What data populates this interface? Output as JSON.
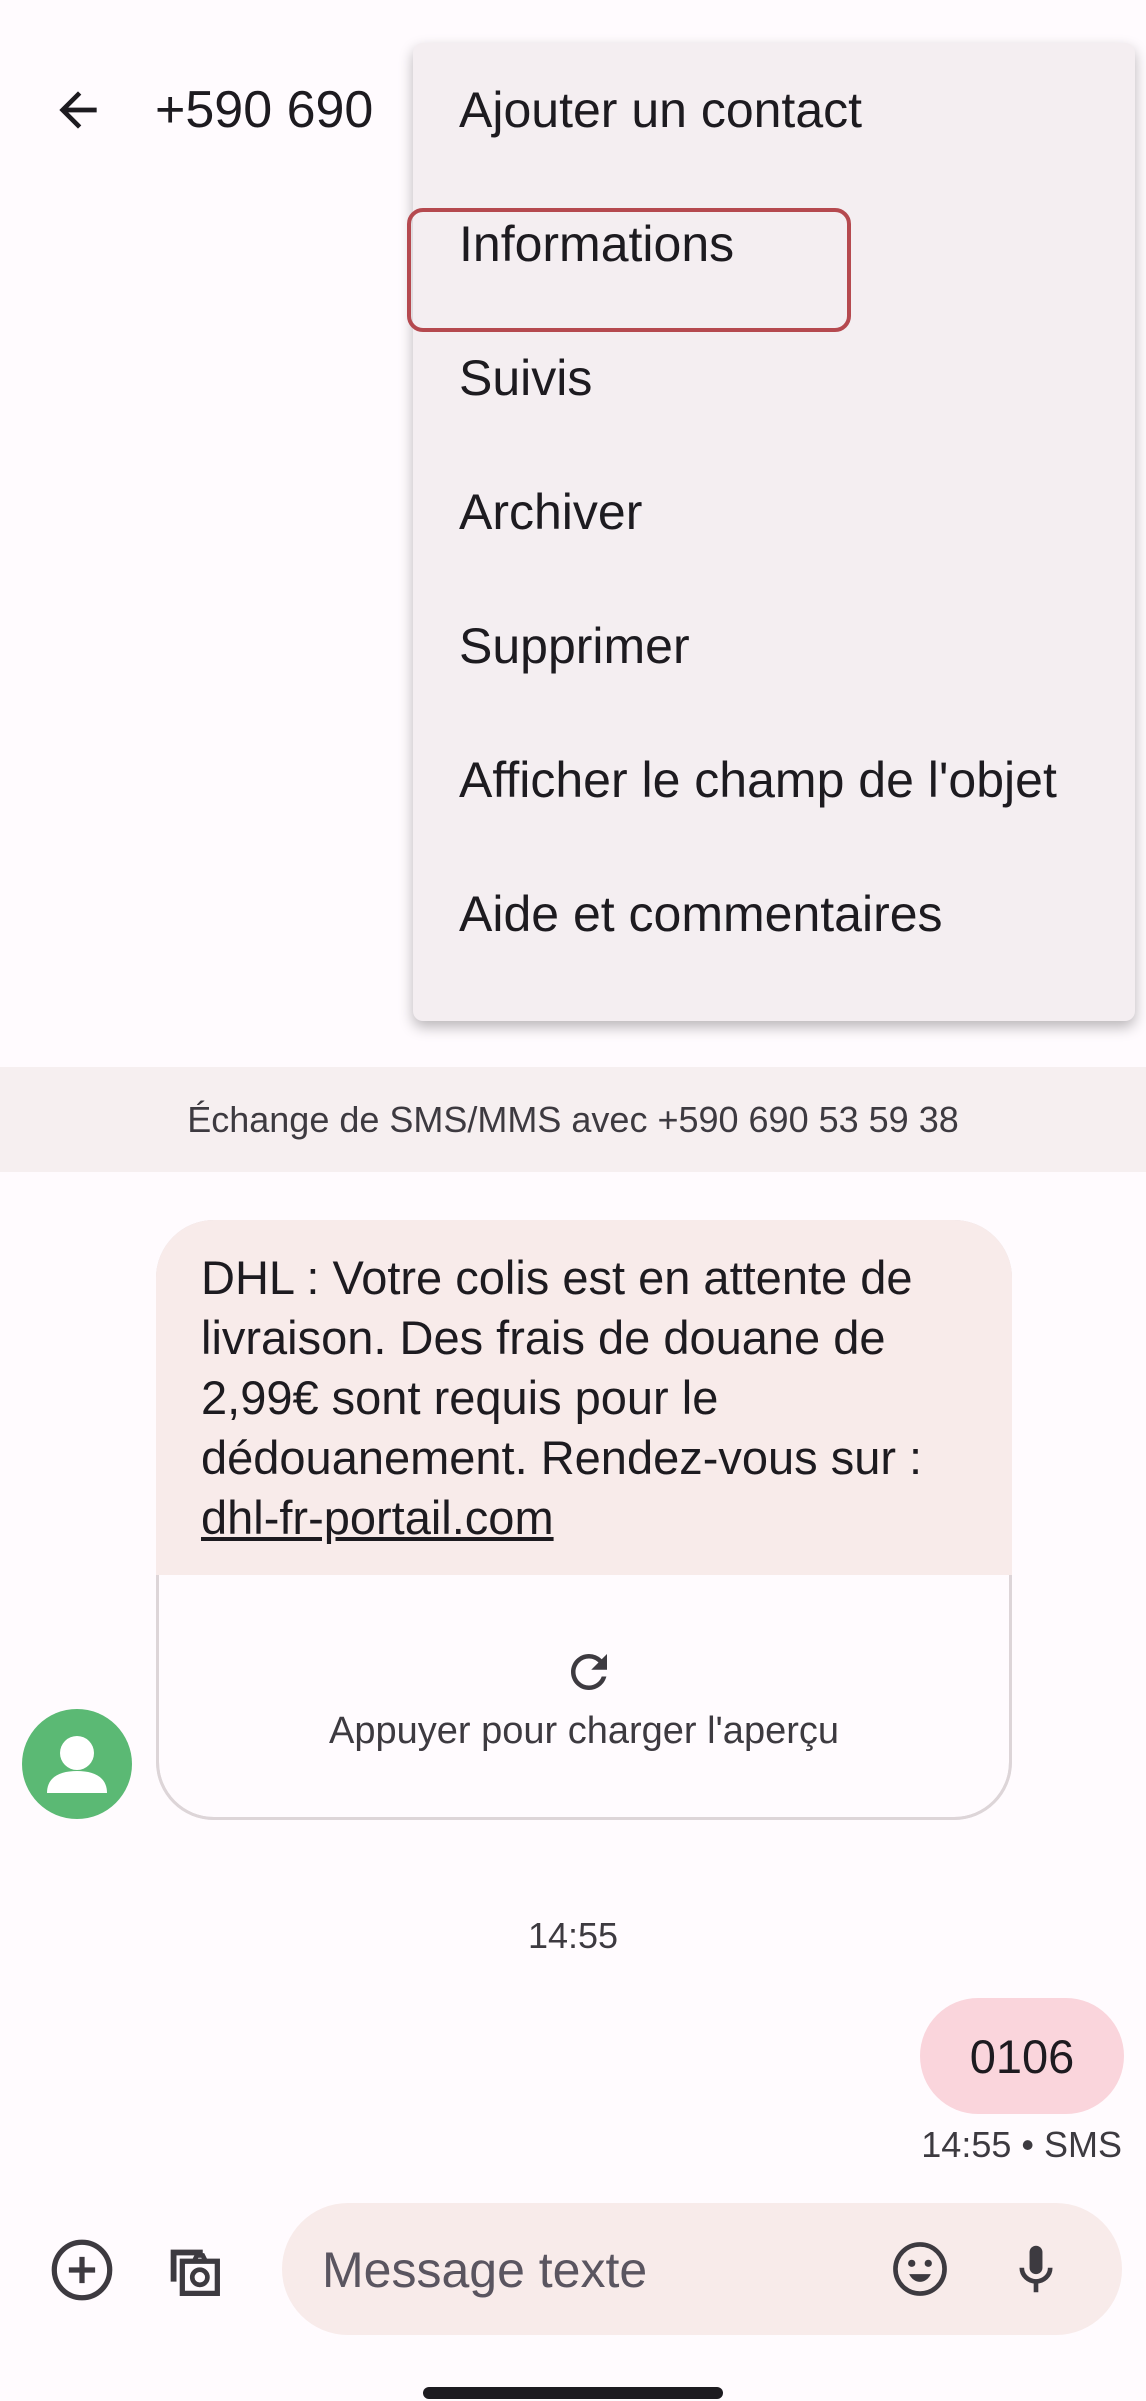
{
  "header": {
    "title": "+590 690"
  },
  "menu": {
    "items": [
      {
        "label": "Ajouter un contact"
      },
      {
        "label": "Informations"
      },
      {
        "label": "Suivis"
      },
      {
        "label": "Archiver"
      },
      {
        "label": "Supprimer"
      },
      {
        "label": "Afficher le champ de l'objet"
      },
      {
        "label": "Aide et commentaires"
      }
    ],
    "highlighted_item": "Informations"
  },
  "conversation": {
    "info_band": "Échange de SMS/MMS avec +590 690 53 59 38",
    "incoming": {
      "text": "DHL : Votre colis est en attente de livraison. Des frais de douane de 2,99€ sont requis pour le dédouanement. Rendez-vous sur :",
      "link": "dhl-fr-portail.com",
      "preview_label": "Appuyer pour charger l'aperçu"
    },
    "time_separator": "14:55",
    "outgoing": {
      "text": "0106",
      "meta": "14:55 • SMS"
    }
  },
  "composer": {
    "placeholder": "Message texte"
  },
  "colors": {
    "background": "#fffbfe",
    "incoming_bubble": "#f8ebea",
    "outgoing_bubble": "#fad5dc",
    "avatar": "#5bb974",
    "menu": "#f4eef1",
    "highlight_border": "#b5494f"
  },
  "icons": {
    "back": "arrow-back-icon",
    "refresh": "refresh-icon",
    "avatar": "person-icon",
    "plus": "add-circle-icon",
    "gallery": "gallery-camera-icon",
    "emoji": "emoji-icon",
    "mic": "mic-icon"
  }
}
